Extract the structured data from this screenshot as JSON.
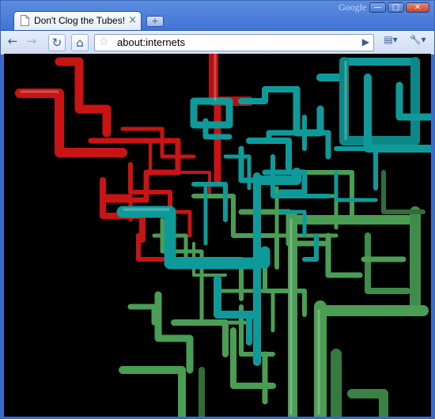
{
  "window": {
    "brand": "Google",
    "controls": {
      "minimize": "—",
      "maximize": "□",
      "close": "✕"
    }
  },
  "tab": {
    "title": "Don't Clog the Tubes!",
    "close": "×"
  },
  "newtab": {
    "label": "+"
  },
  "toolbar": {
    "back": "←",
    "forward": "→",
    "reload": "↻",
    "home": "⌂",
    "star": "☆",
    "url": "about:internets",
    "go": "▶",
    "page_menu": "▤▾",
    "wrench_menu": "🔧▾"
  },
  "content": {
    "description_icons": [
      "tube-red",
      "tube-teal",
      "tube-green"
    ],
    "colors": {
      "red": "#c81414",
      "teal": "#0f9a9a",
      "green": "#4a9e54"
    }
  }
}
